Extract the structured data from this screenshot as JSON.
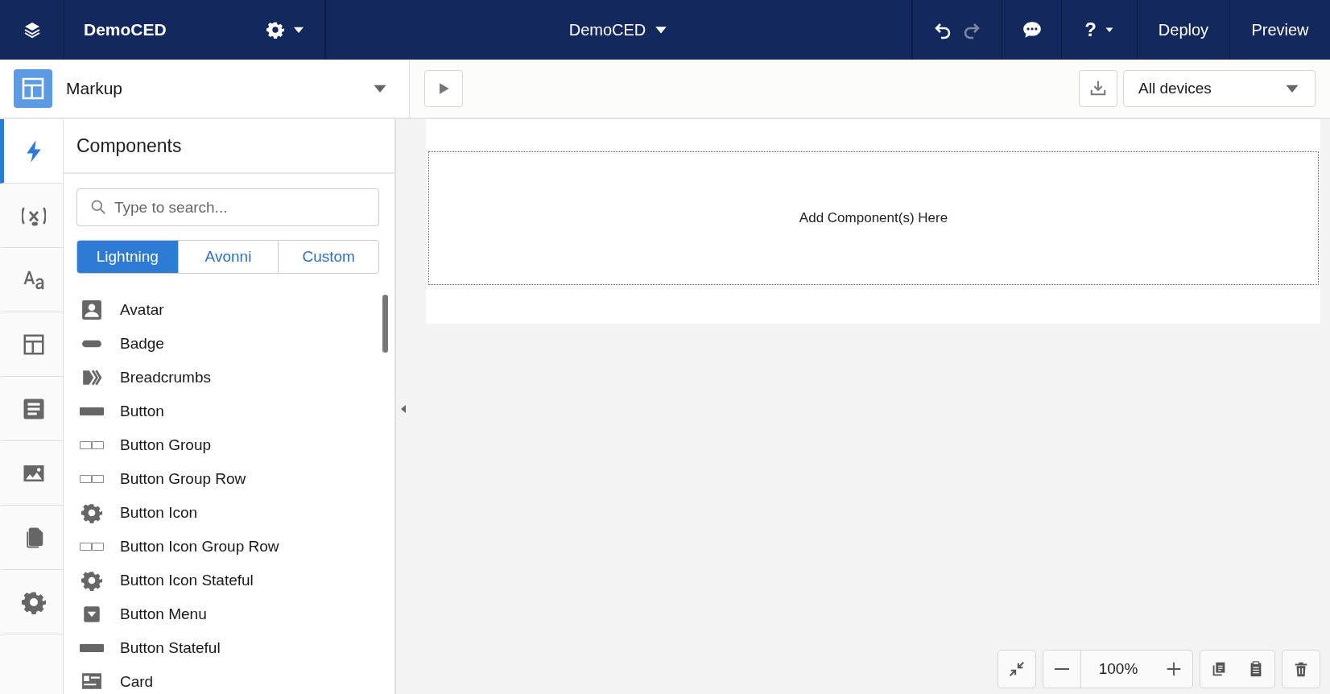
{
  "header": {
    "app_name": "DemoCED",
    "org_name": "DemoCED",
    "undo": {
      "disabled": false
    },
    "redo": {
      "disabled": true
    },
    "help_label": "?",
    "buttons": [
      "Deploy",
      "Preview"
    ]
  },
  "page_selector": {
    "label": "Markup"
  },
  "rail": [
    {
      "kind": "bolt",
      "selected": true
    },
    {
      "kind": "variable",
      "selected": false
    },
    {
      "kind": "text",
      "selected": false
    },
    {
      "kind": "layout",
      "selected": false
    },
    {
      "kind": "list",
      "selected": false
    },
    {
      "kind": "image",
      "selected": false
    },
    {
      "kind": "copy",
      "selected": false
    },
    {
      "kind": "gear",
      "selected": false
    }
  ],
  "components_panel": {
    "title": "Components",
    "search": {
      "placeholder": "Type to search..."
    },
    "tabs": [
      {
        "label": "Lightning",
        "selected": true
      },
      {
        "label": "Avonni",
        "selected": false
      },
      {
        "label": "Custom",
        "selected": false
      }
    ],
    "items": [
      {
        "label": "Avatar",
        "kind": "avatar"
      },
      {
        "label": "Badge",
        "kind": "badge"
      },
      {
        "label": "Breadcrumbs",
        "kind": "breadcrumbs"
      },
      {
        "label": "Button",
        "kind": "button"
      },
      {
        "label": "Button Group",
        "kind": "group"
      },
      {
        "label": "Button Group Row",
        "kind": "group"
      },
      {
        "label": "Button Icon",
        "kind": "gear"
      },
      {
        "label": "Button Icon Group Row",
        "kind": "group"
      },
      {
        "label": "Button Icon Stateful",
        "kind": "gear"
      },
      {
        "label": "Button Menu",
        "kind": "menu"
      },
      {
        "label": "Button Stateful",
        "kind": "button"
      },
      {
        "label": "Card",
        "kind": "card"
      }
    ]
  },
  "canvas": {
    "device": "All devices",
    "drop_zone": "Add Component(s) Here",
    "zoom": "100%"
  }
}
